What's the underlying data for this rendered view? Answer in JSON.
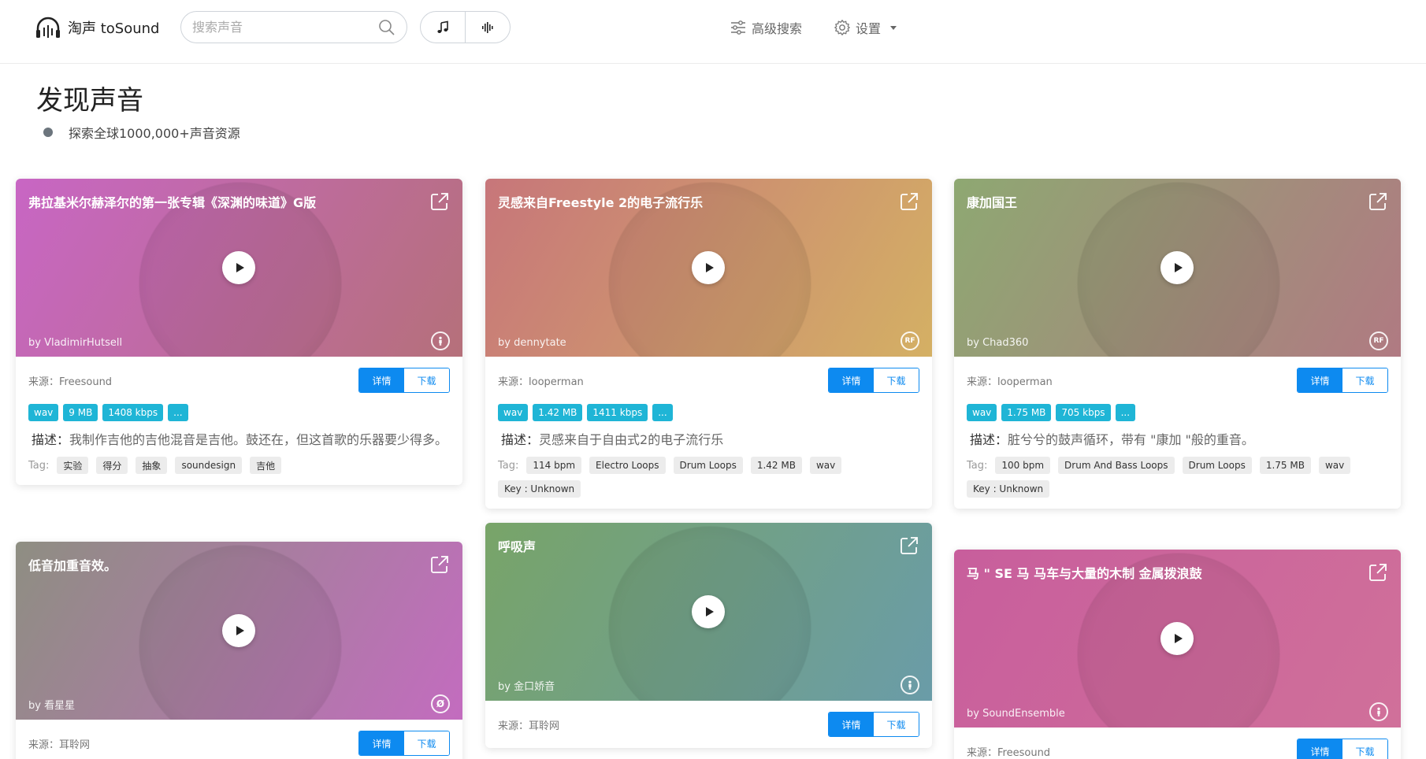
{
  "header": {
    "logo_text": "淘声 toSound",
    "search_placeholder": "搜索声音",
    "advanced_search": "高级搜索",
    "settings": "设置"
  },
  "page": {
    "title": "发现声音",
    "subtitle": "探索全球1000,000+声音资源"
  },
  "labels": {
    "source_prefix": "来源：",
    "detail_btn": "详情",
    "download_btn": "下载",
    "desc_prefix": "描述：",
    "tag_label": "Tag:"
  },
  "cards": [
    {
      "title": "弗拉基米尔赫泽尔的第一张专辑《深渊的味道》G版",
      "author": "by VladimirHutsell",
      "license_icon": "person-icon",
      "gradient": [
        "#c866c4",
        "#b5707a"
      ],
      "source": "Freesound",
      "badges": [
        "wav",
        "9 MB",
        "1408 kbps",
        "..."
      ],
      "description": "我制作吉他的吉他混音是吉他。鼓还在，但这首歌的乐器要少得多。",
      "tags": [
        "实验",
        "得分",
        "抽象",
        "soundesign",
        "吉他"
      ]
    },
    {
      "title": "灵感来自Freestyle 2的电子流行乐",
      "author": "by dennytate",
      "license_icon": "rf-icon",
      "gradient": [
        "#c7767a",
        "#d4b064"
      ],
      "source": "looperman",
      "badges": [
        "wav",
        "1.42 MB",
        "1411 kbps",
        "..."
      ],
      "description": "灵感来自于自由式2的电子流行乐",
      "tags": [
        "114 bpm",
        "Electro Loops",
        "Drum Loops",
        "1.42 MB",
        "wav",
        "Key : Unknown"
      ]
    },
    {
      "title": "康加国王",
      "author": "by Chad360",
      "license_icon": "rf-icon",
      "gradient": [
        "#8ea872",
        "#b07a82"
      ],
      "source": "looperman",
      "badges": [
        "wav",
        "1.75 MB",
        "705 kbps",
        "..."
      ],
      "description": "脏兮兮的鼓声循环，带有 \"康加 \"般的重音。",
      "tags": [
        "100 bpm",
        "Drum And Bass Loops",
        "Drum Loops",
        "1.75 MB",
        "wav",
        "Key : Unknown"
      ]
    },
    {
      "title": "低音加重音效。",
      "author": "by 看星星",
      "license_icon": "zero-icon",
      "gradient": [
        "#8e8e82",
        "#c36cbf"
      ],
      "source": "耳聆网",
      "badges": [],
      "description": "",
      "tags": []
    },
    {
      "title": "呼吸声",
      "author": "by 金口娇音",
      "license_icon": "person-icon",
      "gradient": [
        "#78a468",
        "#6a9ca8"
      ],
      "source": "耳聆网",
      "badges": [],
      "description": "",
      "tags": []
    },
    {
      "title": "马 \" SE 马 马车与大量的木制 金属拨浪鼓",
      "author": "by SoundEnsemble",
      "license_icon": "person-icon",
      "gradient": [
        "#c85e9c",
        "#d0709a"
      ],
      "source": "Freesound",
      "badges": [],
      "description": "",
      "tags": []
    }
  ]
}
